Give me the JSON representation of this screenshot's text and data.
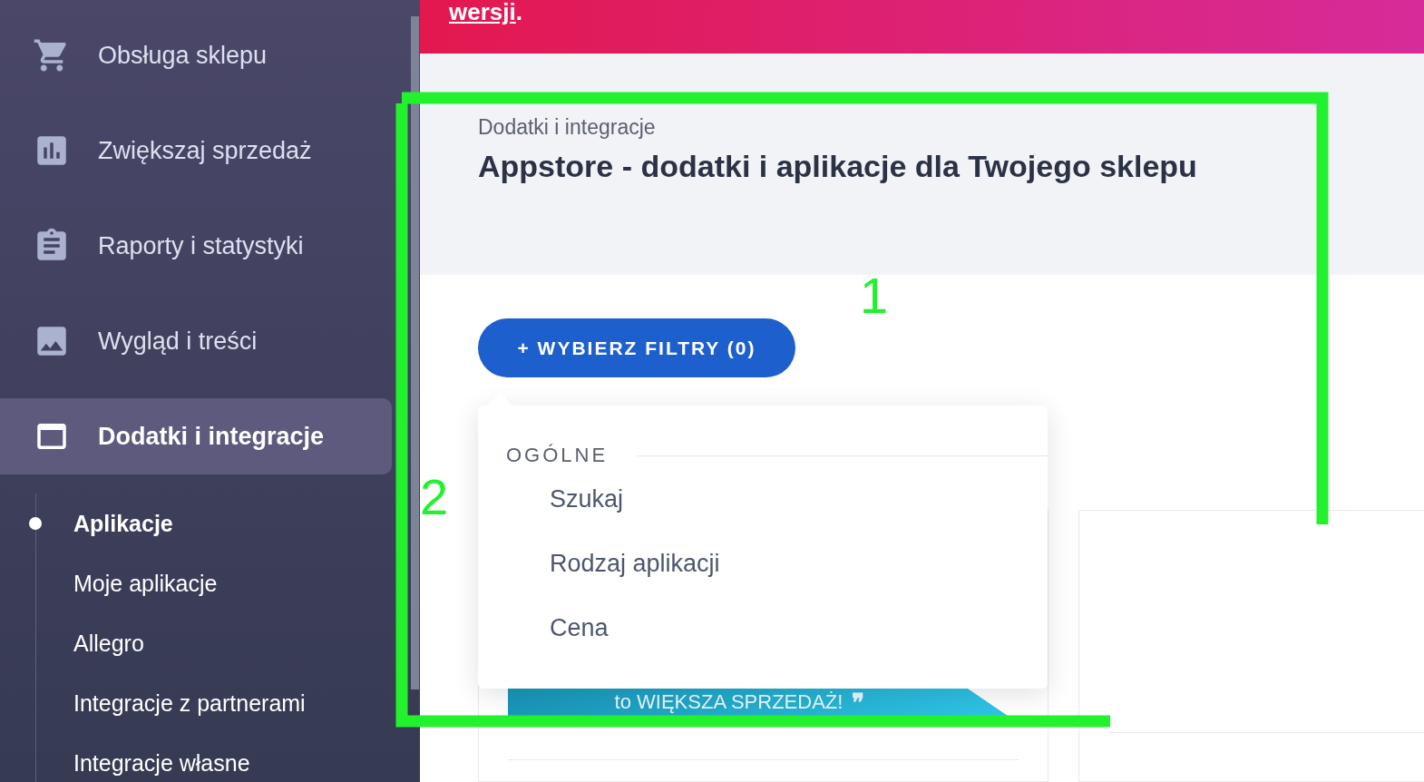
{
  "sidebar": {
    "items": [
      {
        "label": "Obsługa sklepu",
        "kind": "cart",
        "selected": false
      },
      {
        "label": "Zwiększaj sprzedaż",
        "kind": "chart",
        "selected": false
      },
      {
        "label": "Raporty i statystyki",
        "kind": "clipboard",
        "selected": false
      },
      {
        "label": "Wygląd i treści",
        "kind": "image",
        "selected": false
      },
      {
        "label": "Dodatki i integracje",
        "kind": "window",
        "selected": true
      }
    ],
    "subitems": [
      {
        "label": "Aplikacje",
        "selected": true
      },
      {
        "label": "Moje aplikacje",
        "selected": false
      },
      {
        "label": "Allegro",
        "selected": false
      },
      {
        "label": "Integracje z partnerami",
        "selected": false
      },
      {
        "label": "Integracje własne",
        "selected": false
      }
    ]
  },
  "banner": {
    "link": "wersji",
    "text": "."
  },
  "header": {
    "breadcrumb": "Dodatki i integracje",
    "title": "Appstore - dodatki i aplikacje dla Twojego sklepu"
  },
  "filter_button": "+ WYBIERZ FILTRY (0)",
  "dropdown": {
    "section": "OGÓLNE",
    "items": [
      "Szukaj",
      "Rodzaj aplikacji",
      "Cena"
    ]
  },
  "promo": {
    "text": "to WIĘKSZA SPRZEDAŻ!",
    "quote": "❞"
  },
  "annotations": [
    {
      "label": "1"
    },
    {
      "label": "2"
    }
  ]
}
